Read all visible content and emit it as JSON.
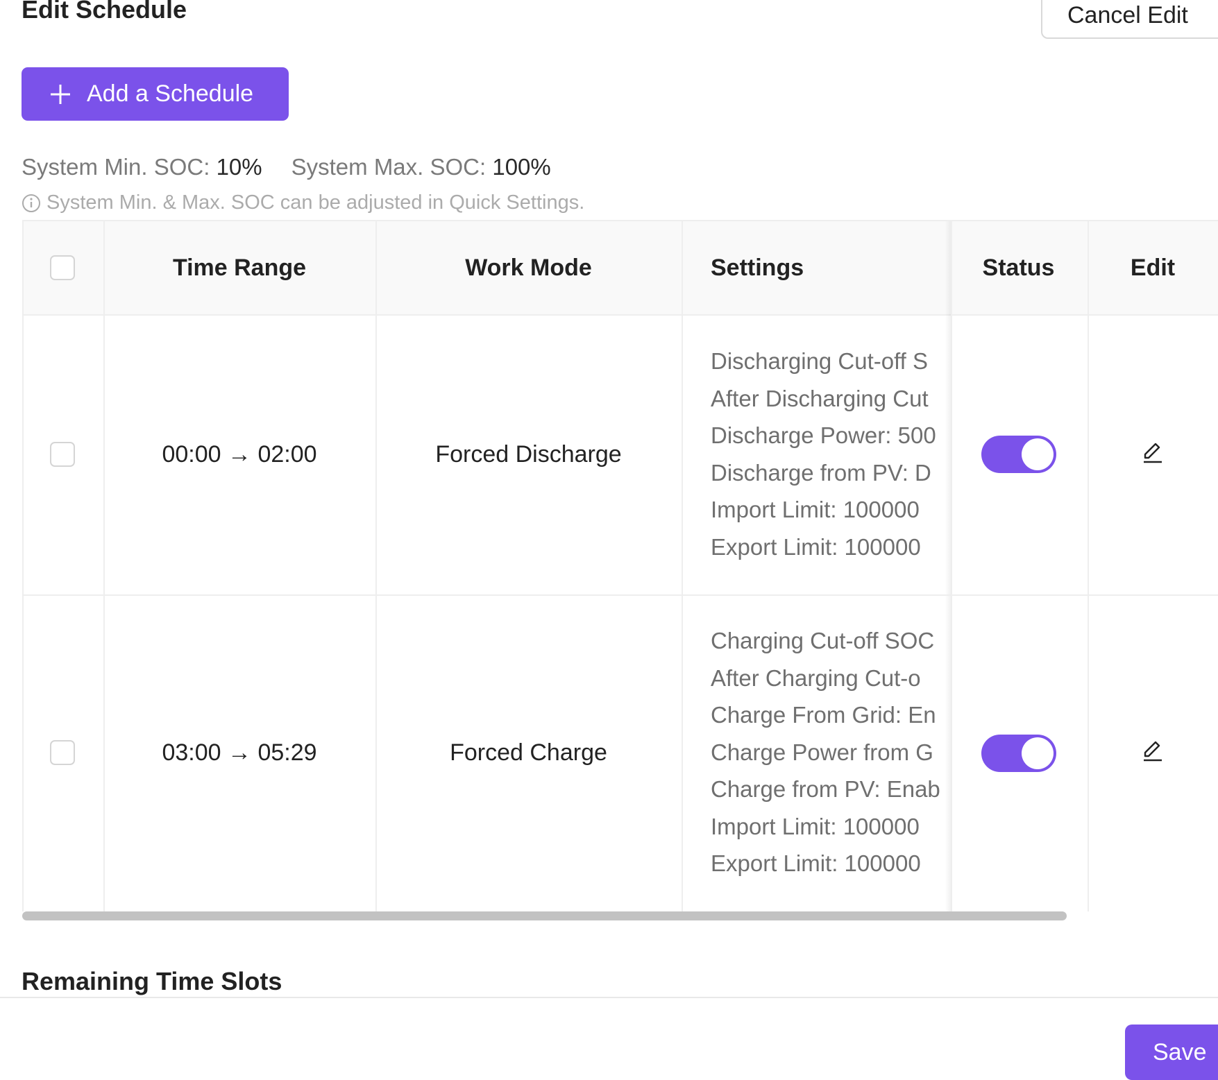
{
  "header": {
    "title": "Edit Schedule",
    "cancel_label": "Cancel Edit"
  },
  "toolbar": {
    "add_label": "Add a Schedule"
  },
  "soc": {
    "min_label": "System Min. SOC: ",
    "min_value": "10%",
    "max_label": "System Max. SOC: ",
    "max_value": "100%",
    "hint": "System Min. & Max. SOC can be adjusted in Quick Settings."
  },
  "table": {
    "headers": {
      "time_range": "Time Range",
      "work_mode": "Work Mode",
      "settings": "Settings",
      "status": "Status",
      "edit": "Edit"
    },
    "rows": [
      {
        "time_range": "00:00 → 02:00",
        "work_mode": "Forced Discharge",
        "settings": [
          "Discharging Cut-off S",
          "After Discharging Cut",
          "Discharge Power: 500",
          "Discharge from PV: D",
          "Import Limit: 100000",
          "Export Limit: 100000"
        ],
        "status_on": true
      },
      {
        "time_range": "03:00 → 05:29",
        "work_mode": "Forced Charge",
        "settings": [
          "Charging Cut-off SOC",
          "After Charging Cut-o",
          "Charge From Grid: En",
          "Charge Power from G",
          "Charge from PV: Enab",
          "Import Limit: 100000",
          "Export Limit: 100000"
        ],
        "status_on": true
      }
    ]
  },
  "remaining": {
    "title": "Remaining Time Slots"
  },
  "footer": {
    "save_label": "Save"
  },
  "colors": {
    "accent": "#7b52ea",
    "border": "#eeeeee",
    "muted_text": "#7a7a7a"
  }
}
